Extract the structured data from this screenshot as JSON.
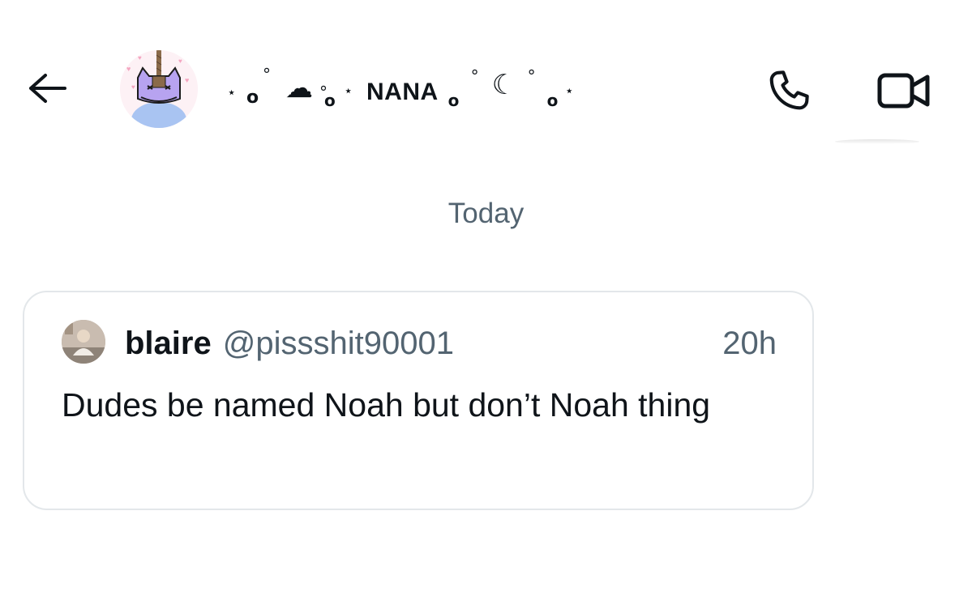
{
  "header": {
    "contact_name": "NANA",
    "deco_left": [
      "⋆",
      "°",
      "☁",
      "°",
      "⋆"
    ],
    "deco_right": [
      "°",
      "°",
      "☾",
      "°",
      "°",
      "⋆"
    ],
    "back_icon": "arrow-left-icon",
    "call_icon": "phone-icon",
    "video_icon": "video-camera-icon"
  },
  "conversation": {
    "date_separator": "Today"
  },
  "quoted_tweet": {
    "display_name": "blaire",
    "handle": "@pissshit90001",
    "time": "20h",
    "text": "Dudes be named Noah but don’t Noah thing"
  },
  "colors": {
    "text_primary": "#0f1419",
    "text_secondary": "#536471",
    "card_border": "#e3e7ea",
    "avatar_accent": "#b7a3f0"
  }
}
